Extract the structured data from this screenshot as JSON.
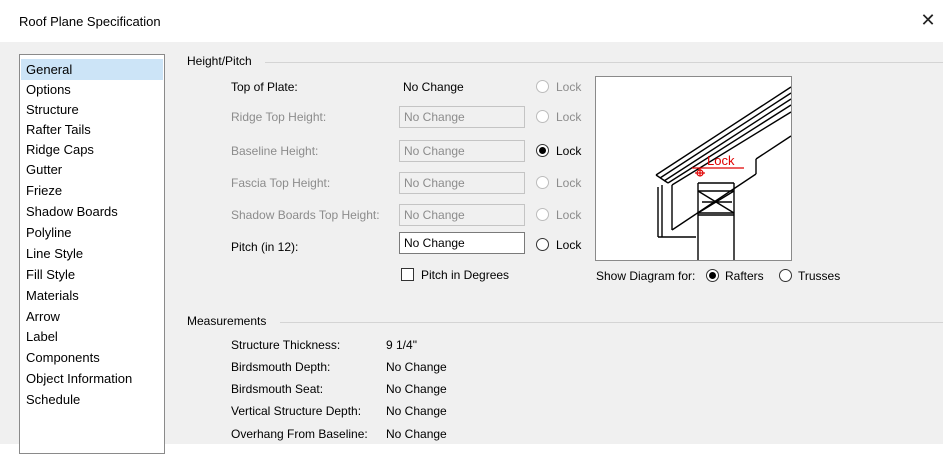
{
  "window": {
    "title": "Roof Plane Specification",
    "close_icon": "close-icon"
  },
  "sidebar": {
    "selected_index": 0,
    "items": [
      "General",
      "Options",
      "Structure",
      "Rafter Tails",
      "Ridge Caps",
      "Gutter",
      "Frieze",
      "Shadow Boards",
      "Polyline",
      "Line Style",
      "Fill Style",
      "Materials",
      "Arrow",
      "Label",
      "Components",
      "Object Information",
      "Schedule"
    ]
  },
  "height_pitch": {
    "title": "Height/Pitch",
    "top_of_plate": {
      "label": "Top of Plate:",
      "value": "No Change",
      "lock": "Lock",
      "lock_selected": false,
      "enabled": false
    },
    "ridge_top_height": {
      "label": "Ridge Top Height:",
      "value": "No Change",
      "lock": "Lock",
      "lock_selected": false,
      "enabled": false
    },
    "baseline_height": {
      "label": "Baseline Height:",
      "value": "No Change",
      "lock": "Lock",
      "lock_selected": true,
      "enabled": true
    },
    "fascia_top_height": {
      "label": "Fascia Top Height:",
      "value": "No Change",
      "lock": "Lock",
      "lock_selected": false,
      "enabled": false
    },
    "shadow_boards_top_height": {
      "label": "Shadow Boards Top Height:",
      "value": "No Change",
      "lock": "Lock",
      "lock_selected": false,
      "enabled": false
    },
    "pitch": {
      "label": "Pitch (in 12):",
      "value": "No Change",
      "lock": "Lock",
      "lock_selected": false,
      "enabled": true
    },
    "pitch_in_degrees": {
      "label": "Pitch in Degrees",
      "checked": false
    }
  },
  "diagram": {
    "lock_text": "Lock",
    "show_for_label": "Show Diagram for:",
    "options": [
      {
        "label": "Rafters",
        "selected": true
      },
      {
        "label": "Trusses",
        "selected": false
      }
    ],
    "accent_color": "#e00000"
  },
  "measurements": {
    "title": "Measurements",
    "rows": [
      {
        "label": "Structure Thickness:",
        "value": "9 1/4\""
      },
      {
        "label": "Birdsmouth Depth:",
        "value": "No Change"
      },
      {
        "label": "Birdsmouth Seat:",
        "value": "No Change"
      },
      {
        "label": "Vertical Structure Depth:",
        "value": "No Change"
      },
      {
        "label": "Overhang From Baseline:",
        "value": "No Change"
      }
    ]
  }
}
